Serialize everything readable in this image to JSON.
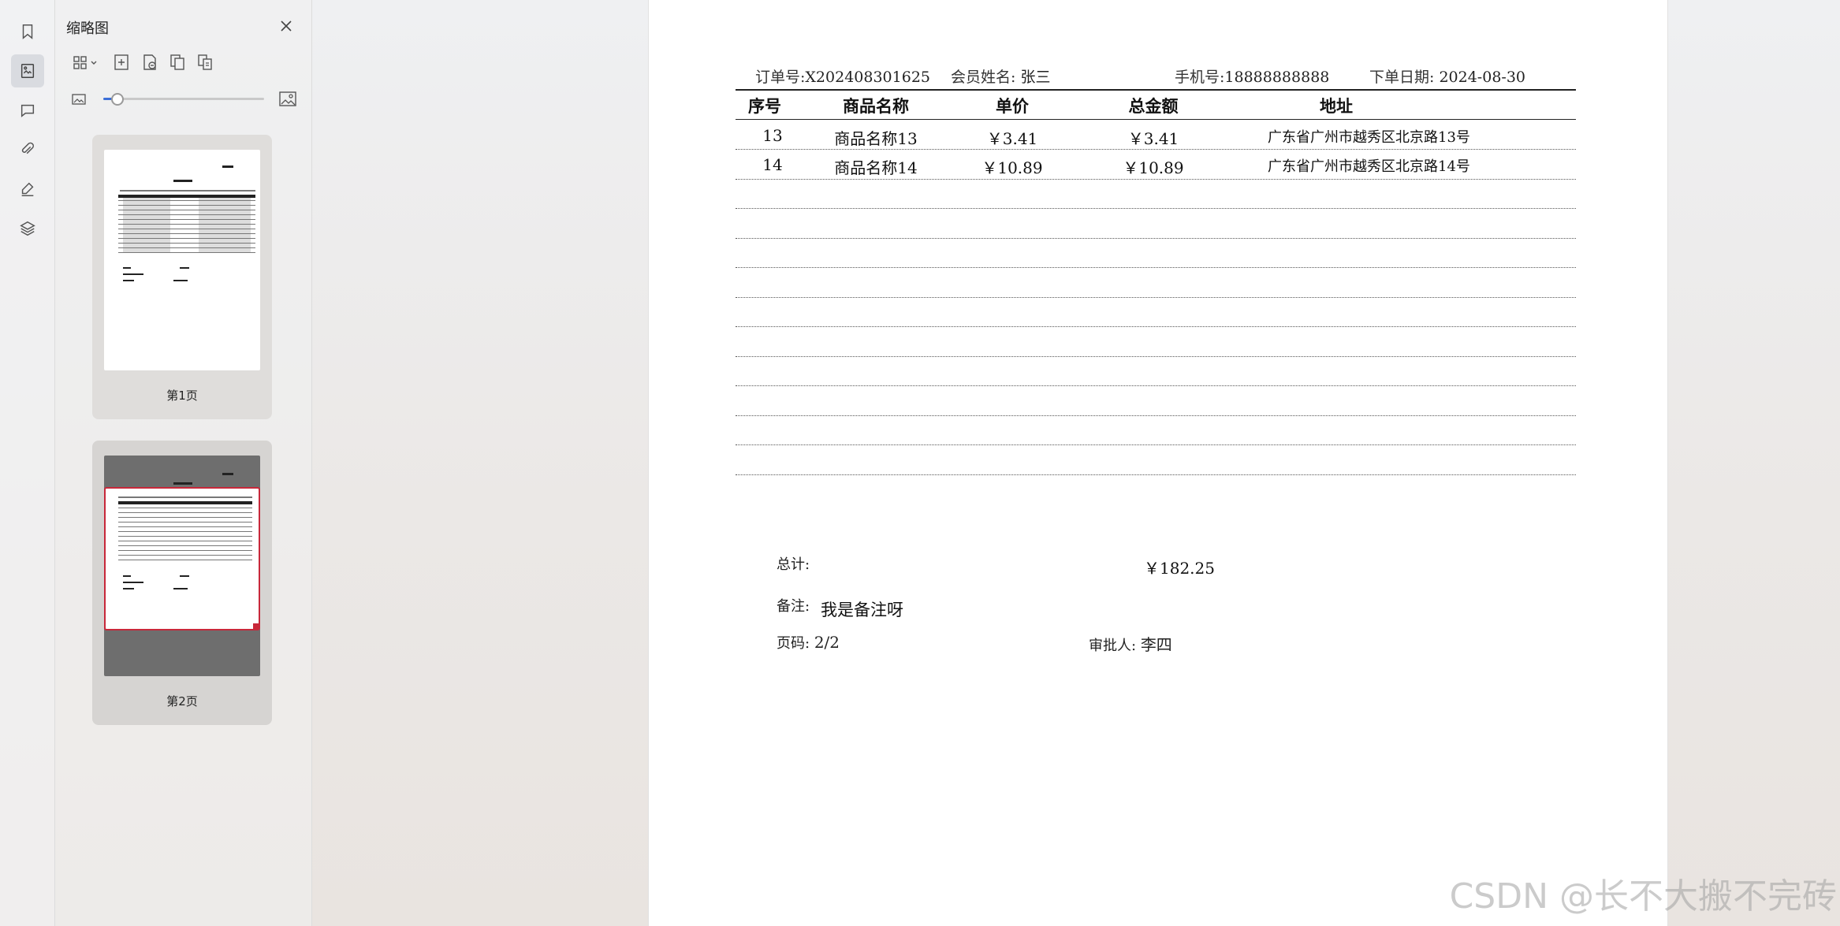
{
  "panel": {
    "title": "缩略图",
    "zoom_level_fraction": 0.09,
    "pages": [
      {
        "label": "第1页",
        "selected": false
      },
      {
        "label": "第2页",
        "selected": true
      }
    ]
  },
  "document": {
    "header": {
      "order_no_label": "订单号:",
      "order_no": "X202408301625",
      "member_label": "会员姓名:",
      "member": "张三",
      "phone_label": "手机号:",
      "phone": "18888888888",
      "date_label": "下单日期:",
      "date": "2024-08-30"
    },
    "columns": [
      "序号",
      "商品名称",
      "单价",
      "总金额",
      "地址"
    ],
    "rows": [
      [
        "13",
        "商品名称13",
        "￥3.41",
        "￥3.41",
        "广东省广州市越秀区北京路13号"
      ],
      [
        "14",
        "商品名称14",
        "￥10.89",
        "￥10.89",
        "广东省广州市越秀区北京路14号"
      ]
    ],
    "footer": {
      "total_label": "总计:",
      "total_value": "￥182.25",
      "remark_label": "备注:",
      "remark_value": "我是备注呀",
      "page_label": "页码:",
      "page_value": "2/2",
      "approver_label": "审批人:",
      "approver_value": "李四"
    }
  },
  "watermark": "CSDN @长不大搬不完砖",
  "colors": {
    "accent": "#3b6fd8",
    "selected_border": "#c8283a"
  }
}
